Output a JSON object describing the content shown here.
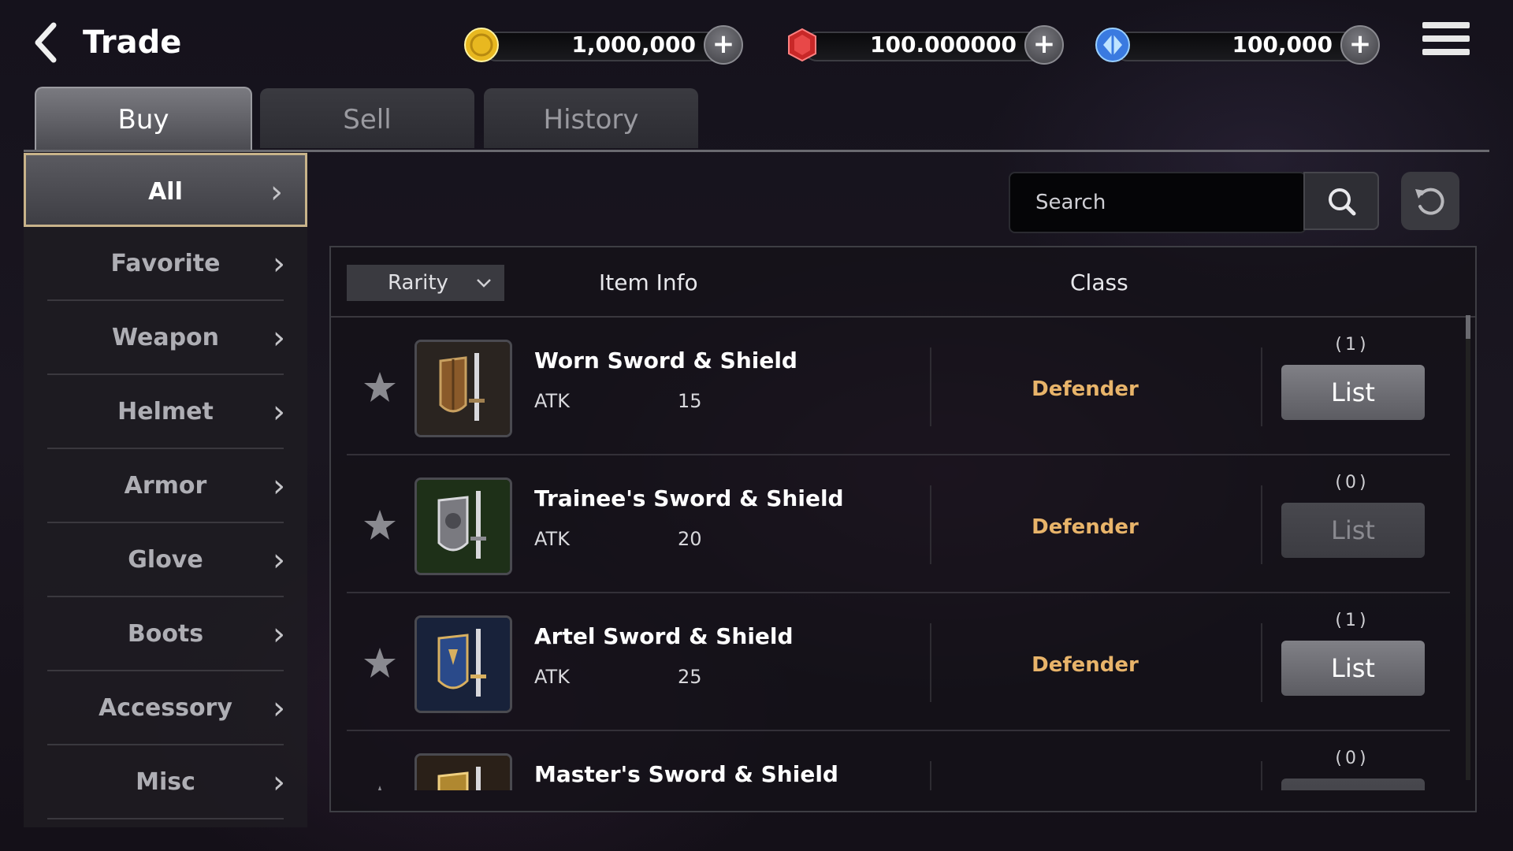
{
  "header": {
    "title": "Trade",
    "currencies": [
      {
        "icon": "gold-coin-icon",
        "value": "1,000,000",
        "color": "#e8b820"
      },
      {
        "icon": "red-gem-icon",
        "value": "100.000000",
        "color": "#d03030"
      },
      {
        "icon": "blue-diamond-icon",
        "value": "100,000",
        "color": "#3a7ae0"
      }
    ]
  },
  "tabs": [
    "Buy",
    "Sell",
    "History"
  ],
  "active_tab": "Buy",
  "sidebar": {
    "items": [
      "All",
      "Favorite",
      "Weapon",
      "Helmet",
      "Armor",
      "Glove",
      "Boots",
      "Accessory",
      "Misc"
    ],
    "active": "All"
  },
  "search": {
    "placeholder": "Search"
  },
  "table": {
    "rarity_label": "Rarity",
    "col_item": "Item Info",
    "col_class": "Class",
    "rows": [
      {
        "name": "Worn Sword & Shield",
        "stat": "ATK",
        "stat_value": "15",
        "class": "Defender",
        "count": "(1)",
        "button": "List",
        "enabled": true,
        "frame_color": "#8a6a40"
      },
      {
        "name": "Trainee's Sword & Shield",
        "stat": "ATK",
        "stat_value": "20",
        "class": "Defender",
        "count": "(0)",
        "button": "List",
        "enabled": false,
        "frame_color": "#4a6a3a"
      },
      {
        "name": "Artel Sword & Shield",
        "stat": "ATK",
        "stat_value": "25",
        "class": "Defender",
        "count": "(1)",
        "button": "List",
        "enabled": true,
        "frame_color": "#2a4a8a"
      },
      {
        "name": "Master's Sword & Shield",
        "stat": "",
        "stat_value": "",
        "class": "",
        "count": "(0)",
        "button": "",
        "enabled": false,
        "frame_color": "#8a6a30"
      }
    ]
  }
}
